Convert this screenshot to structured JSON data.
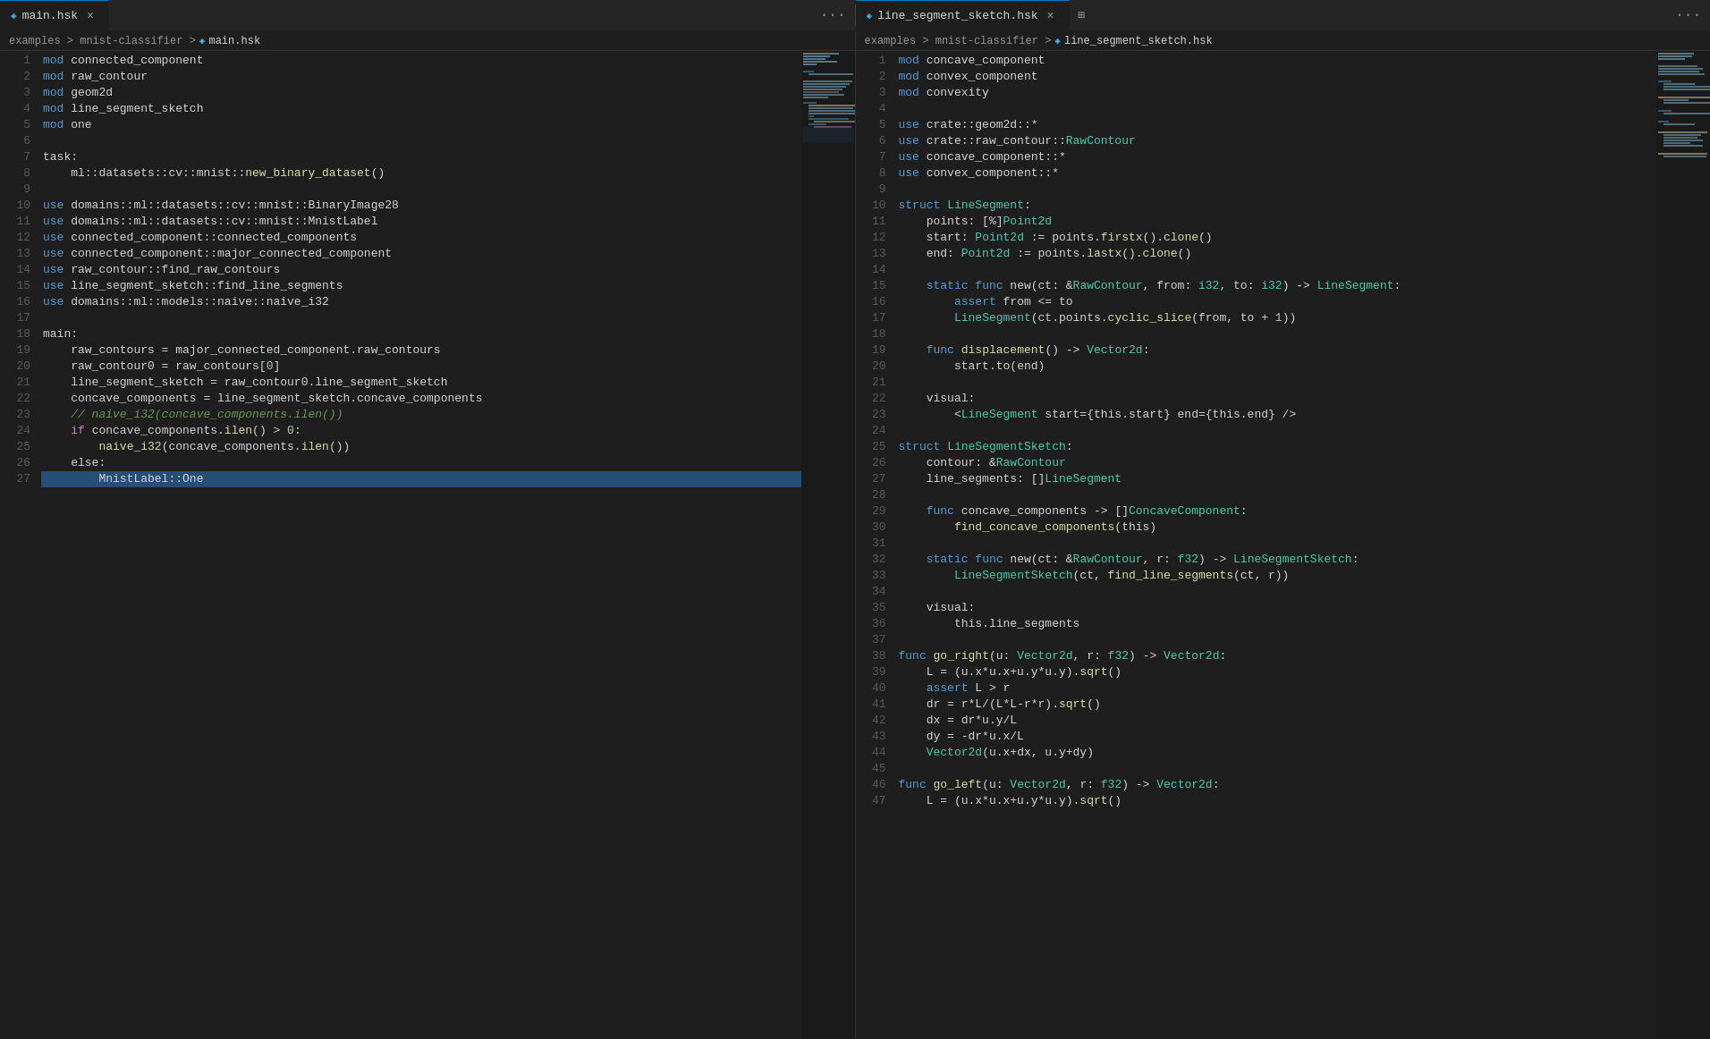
{
  "tabs": {
    "left": {
      "label": "main.hsk",
      "active": true,
      "icon": "file-icon"
    },
    "right": {
      "label": "line_segment_sketch.hsk",
      "active": true,
      "icon": "file-icon"
    }
  },
  "breadcrumbs": {
    "left": {
      "path": "examples > mnist-classifier >",
      "file": "main.hsk"
    },
    "right": {
      "path": "examples > mnist-classifier >",
      "file": "line_segment_sketch.hsk"
    }
  },
  "left_code": [
    {
      "n": 1,
      "t": "mod connected_component"
    },
    {
      "n": 2,
      "t": "mod raw_contour"
    },
    {
      "n": 3,
      "t": "mod geom2d"
    },
    {
      "n": 4,
      "t": "mod line_segment_sketch"
    },
    {
      "n": 5,
      "t": "mod one"
    },
    {
      "n": 6,
      "t": ""
    },
    {
      "n": 7,
      "t": "task:"
    },
    {
      "n": 8,
      "t": "    ml::datasets::cv::mnist::new_binary_dataset()"
    },
    {
      "n": 9,
      "t": ""
    },
    {
      "n": 10,
      "t": "use domains::ml::datasets::cv::mnist::BinaryImage28"
    },
    {
      "n": 11,
      "t": "use domains::ml::datasets::cv::mnist::MnistLabel"
    },
    {
      "n": 12,
      "t": "use connected_component::connected_components"
    },
    {
      "n": 13,
      "t": "use connected_component::major_connected_component"
    },
    {
      "n": 14,
      "t": "use raw_contour::find_raw_contours"
    },
    {
      "n": 15,
      "t": "use line_segment_sketch::find_line_segments"
    },
    {
      "n": 16,
      "t": "use domains::ml::models::naive::naive_i32"
    },
    {
      "n": 17,
      "t": ""
    },
    {
      "n": 18,
      "t": "main:"
    },
    {
      "n": 19,
      "t": "    raw_contours = major_connected_component.raw_contours"
    },
    {
      "n": 20,
      "t": "    raw_contour0 = raw_contours[0]"
    },
    {
      "n": 21,
      "t": "    line_segment_sketch = raw_contour0.line_segment_sketch"
    },
    {
      "n": 22,
      "t": "    concave_components = line_segment_sketch.concave_components"
    },
    {
      "n": 23,
      "t": "    // naive_i32(concave_components.ilen())"
    },
    {
      "n": 24,
      "t": "    if concave_components.ilen() > 0:"
    },
    {
      "n": 25,
      "t": "        naive_i32(concave_components.ilen())"
    },
    {
      "n": 26,
      "t": "    else:"
    },
    {
      "n": 27,
      "t": "        MnistLabel::One"
    }
  ],
  "right_code": [
    {
      "n": 1,
      "t": "mod concave_component"
    },
    {
      "n": 2,
      "t": "mod convex_component"
    },
    {
      "n": 3,
      "t": "mod convexity"
    },
    {
      "n": 4,
      "t": ""
    },
    {
      "n": 5,
      "t": "use crate::geom2d::*"
    },
    {
      "n": 6,
      "t": "use crate::raw_contour::RawContour"
    },
    {
      "n": 7,
      "t": "use concave_component::*"
    },
    {
      "n": 8,
      "t": "use convex_component::*"
    },
    {
      "n": 9,
      "t": ""
    },
    {
      "n": 10,
      "t": "struct LineSegment:"
    },
    {
      "n": 11,
      "t": "    points: [%]Point2d"
    },
    {
      "n": 12,
      "t": "    start: Point2d := points.firstx().clone()"
    },
    {
      "n": 13,
      "t": "    end: Point2d := points.lastx().clone()"
    },
    {
      "n": 14,
      "t": ""
    },
    {
      "n": 15,
      "t": "    static func new(ct: &RawContour, from: i32, to: i32) -> LineSegment:"
    },
    {
      "n": 16,
      "t": "        assert from <= to"
    },
    {
      "n": 17,
      "t": "        LineSegment(ct.points.cyclic_slice(from, to + 1))"
    },
    {
      "n": 18,
      "t": ""
    },
    {
      "n": 19,
      "t": "    func displacement() -> Vector2d:"
    },
    {
      "n": 20,
      "t": "        start.to(end)"
    },
    {
      "n": 21,
      "t": ""
    },
    {
      "n": 22,
      "t": "    visual:"
    },
    {
      "n": 23,
      "t": "        <LineSegment start={this.start} end={this.end} />"
    },
    {
      "n": 24,
      "t": ""
    },
    {
      "n": 25,
      "t": "struct LineSegmentSketch:"
    },
    {
      "n": 26,
      "t": "    contour: &RawContour"
    },
    {
      "n": 27,
      "t": "    line_segments: []LineSegment"
    },
    {
      "n": 28,
      "t": ""
    },
    {
      "n": 29,
      "t": "    func concave_components -> []ConcaveComponent:"
    },
    {
      "n": 30,
      "t": "        find_concave_components(this)"
    },
    {
      "n": 31,
      "t": ""
    },
    {
      "n": 32,
      "t": "    static func new(ct: &RawContour, r: f32) -> LineSegmentSketch:"
    },
    {
      "n": 33,
      "t": "        LineSegmentSketch(ct, find_line_segments(ct, r))"
    },
    {
      "n": 34,
      "t": ""
    },
    {
      "n": 35,
      "t": "    visual:"
    },
    {
      "n": 36,
      "t": "        this.line_segments"
    },
    {
      "n": 37,
      "t": ""
    },
    {
      "n": 38,
      "t": "func go_right(u: Vector2d, r: f32) -> Vector2d:"
    },
    {
      "n": 39,
      "t": "    L = (u.x*u.x+u.y*u.y).sqrt()"
    },
    {
      "n": 40,
      "t": "    assert L > r"
    },
    {
      "n": 41,
      "t": "    dr = r*L/(L*L-r*r).sqrt()"
    },
    {
      "n": 42,
      "t": "    dx = dr*u.y/L"
    },
    {
      "n": 43,
      "t": "    dy = -dr*u.x/L"
    },
    {
      "n": 44,
      "t": "    Vector2d(u.x+dx, u.y+dy)"
    },
    {
      "n": 45,
      "t": ""
    },
    {
      "n": 46,
      "t": "func go_left(u: Vector2d, r: f32) -> Vector2d:"
    },
    {
      "n": 47,
      "t": "    L = (u.x*u.x+u.y*u.y).sqrt()"
    }
  ]
}
